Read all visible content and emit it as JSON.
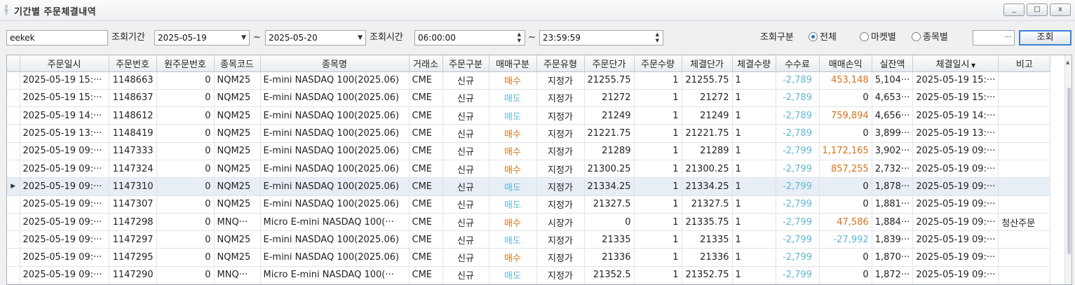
{
  "window": {
    "title": "기간별 주문체결내역",
    "buttons": {
      "minimize": "_",
      "maximize": "□",
      "close": "x"
    }
  },
  "toolbar": {
    "account_value": "eekek",
    "period_label": "조회기간",
    "date_from": "2025-05-19",
    "tilde": "~",
    "date_to": "2025-05-20",
    "time_label": "조회시간",
    "time_from": "06:00:00",
    "time_to": "23:59:59",
    "category_label": "조회구분",
    "radio_options": [
      {
        "label": "전체",
        "selected": true
      },
      {
        "label": "마켓별",
        "selected": false
      },
      {
        "label": "종목별",
        "selected": false
      }
    ],
    "symbol_value": "",
    "ellipsis": "···",
    "search_button": "조회"
  },
  "table": {
    "columns": [
      "주문일시",
      "주문번호",
      "원주문번호",
      "종목코드",
      "종목명",
      "거래소",
      "주문구분",
      "매매구분",
      "주문유형",
      "주문단가",
      "주문수량",
      "체결단가",
      "체결수량",
      "수수료",
      "매매손익",
      "실잔액",
      "체결일시",
      "비고"
    ],
    "selected_row_index": 6,
    "rows": [
      [
        "2025-05-19 15:···",
        "1148663",
        "0",
        "NQM25",
        "E-mini NASDAQ 100(2025.06)",
        "CME",
        "신규",
        "매수",
        "지정가",
        "21255.75",
        "1",
        "21255.75",
        "1",
        "-2,789",
        "453,148",
        "5,104···",
        "2025-05-19 15:···",
        ""
      ],
      [
        "2025-05-19 15:···",
        "1148637",
        "0",
        "NQM25",
        "E-mini NASDAQ 100(2025.06)",
        "CME",
        "신규",
        "매도",
        "지정가",
        "21272",
        "1",
        "21272",
        "1",
        "-2,789",
        "0",
        "4,653···",
        "2025-05-19 15:···",
        ""
      ],
      [
        "2025-05-19 14:···",
        "1148612",
        "0",
        "NQM25",
        "E-mini NASDAQ 100(2025.06)",
        "CME",
        "신규",
        "매도",
        "지정가",
        "21249",
        "1",
        "21249",
        "1",
        "-2,789",
        "759,894",
        "4,656···",
        "2025-05-19 14:···",
        ""
      ],
      [
        "2025-05-19 13:···",
        "1148419",
        "0",
        "NQM25",
        "E-mini NASDAQ 100(2025.06)",
        "CME",
        "신규",
        "매수",
        "지정가",
        "21221.75",
        "1",
        "21221.75",
        "1",
        "-2,789",
        "0",
        "3,899···",
        "2025-05-19 13:···",
        ""
      ],
      [
        "2025-05-19 09:···",
        "1147333",
        "0",
        "NQM25",
        "E-mini NASDAQ 100(2025.06)",
        "CME",
        "신규",
        "매수",
        "지정가",
        "21289",
        "1",
        "21289",
        "1",
        "-2,799",
        "1,172,165",
        "3,902···",
        "2025-05-19 09:···",
        ""
      ],
      [
        "2025-05-19 09:···",
        "1147324",
        "0",
        "NQM25",
        "E-mini NASDAQ 100(2025.06)",
        "CME",
        "신규",
        "매수",
        "지정가",
        "21300.25",
        "1",
        "21300.25",
        "1",
        "-2,799",
        "857,255",
        "2,732···",
        "2025-05-19 09:···",
        ""
      ],
      [
        "2025-05-19 09:···",
        "1147310",
        "0",
        "NQM25",
        "E-mini NASDAQ 100(2025.06)",
        "CME",
        "신규",
        "매도",
        "지정가",
        "21334.25",
        "1",
        "21334.25",
        "1",
        "-2,799",
        "0",
        "1,878···",
        "2025-05-19 09:···",
        ""
      ],
      [
        "2025-05-19 09:···",
        "1147307",
        "0",
        "NQM25",
        "E-mini NASDAQ 100(2025.06)",
        "CME",
        "신규",
        "매도",
        "지정가",
        "21327.5",
        "1",
        "21327.5",
        "1",
        "-2,799",
        "0",
        "1,881···",
        "2025-05-19 09:···",
        ""
      ],
      [
        "2025-05-19 09:···",
        "1147298",
        "0",
        "MNQ···",
        "Micro E-mini NASDAQ 100(···",
        "CME",
        "신규",
        "매수",
        "시장가",
        "0",
        "1",
        "21335.75",
        "1",
        "-2,799",
        "47,586",
        "1,884···",
        "2025-05-19 09:···",
        "청산주문"
      ],
      [
        "2025-05-19 09:···",
        "1147297",
        "0",
        "NQM25",
        "E-mini NASDAQ 100(2025.06)",
        "CME",
        "신규",
        "매도",
        "지정가",
        "21335",
        "1",
        "21335",
        "1",
        "-2,799",
        "-27,992",
        "1,839···",
        "2025-05-19 09:···",
        ""
      ],
      [
        "2025-05-19 09:···",
        "1147295",
        "0",
        "NQM25",
        "E-mini NASDAQ 100(2025.06)",
        "CME",
        "신규",
        "매수",
        "지정가",
        "21336",
        "1",
        "21336",
        "1",
        "-2,799",
        "0",
        "1,870···",
        "2025-05-19 09:···",
        ""
      ],
      [
        "2025-05-19 09:···",
        "1147290",
        "0",
        "MNQ···",
        "Micro E-mini NASDAQ 100(···",
        "CME",
        "신규",
        "매도",
        "지정가",
        "21352.5",
        "1",
        "21352.75",
        "1",
        "-2,799",
        "0",
        "1,872···",
        "2025-05-19 09:···",
        ""
      ]
    ]
  },
  "colors": {
    "buy": "#d9701a",
    "sell": "#5fb6d8",
    "fee": "#5fb6d8",
    "accent": "#3d7fd6"
  }
}
